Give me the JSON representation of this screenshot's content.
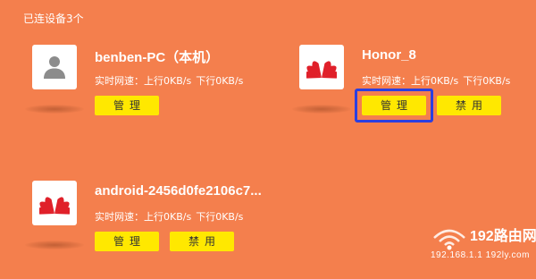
{
  "header": {
    "title": "已连设备3个"
  },
  "devices": [
    {
      "name": "benben-PC（本机）",
      "icon": "user-icon",
      "speed_label": "实时网速：",
      "upload": "上行0KB/s",
      "download": "下行0KB/s",
      "manage_label": "管理"
    },
    {
      "name": "Honor_8",
      "icon": "huawei-logo-icon",
      "speed_label": "实时网速：",
      "upload": "上行0KB/s",
      "download": "下行0KB/s",
      "manage_label": "管理",
      "disable_label": "禁用"
    },
    {
      "name": "android-2456d0fe2106c7...",
      "icon": "huawei-logo-icon",
      "speed_label": "实时网速：",
      "upload": "上行0KB/s",
      "download": "下行0KB/s",
      "manage_label": "管理",
      "disable_label": "禁用"
    }
  ],
  "watermark": {
    "brand": "192路由网",
    "domain": "192.168.1.1 192ly.com"
  },
  "colors": {
    "background": "#F47F4D",
    "button": "#FFE800",
    "highlight": "#2A3FE0",
    "huawei_red": "#E0202A",
    "user_gray": "#8C8C8C"
  }
}
